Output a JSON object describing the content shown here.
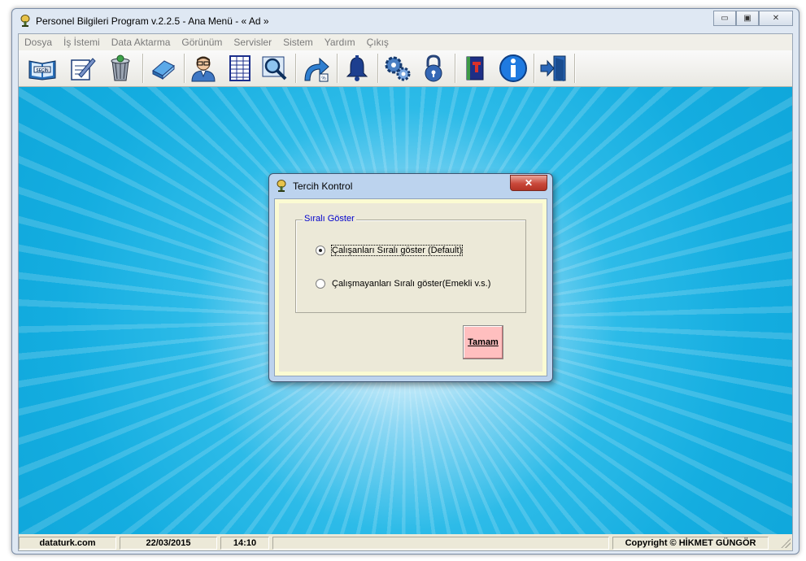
{
  "window": {
    "title": "Personel Bilgileri Program v.2.2.5  - Ana Menü -  « Ad »",
    "caption_buttons": [
      "minimize-icon",
      "maximize-icon",
      "close-icon"
    ]
  },
  "menu": [
    "Dosya",
    "İş İstemi",
    "Data Aktarma",
    "Görünüm",
    "Servisler",
    "Sistem",
    "Yardım",
    "Çıkış"
  ],
  "toolbar": [
    {
      "name": "secim-book-icon",
      "text": "SEÇİN"
    },
    {
      "name": "edit-form-icon"
    },
    {
      "name": "recycle-bin-icon"
    },
    {
      "name": "eraser-icon"
    },
    {
      "name": "person-icon"
    },
    {
      "name": "spreadsheet-icon"
    },
    {
      "name": "search-icon"
    },
    {
      "name": "export-arrow-icon"
    },
    {
      "name": "bell-icon"
    },
    {
      "name": "gears-icon"
    },
    {
      "name": "lock-icon"
    },
    {
      "name": "help-book-icon"
    },
    {
      "name": "info-icon"
    },
    {
      "name": "exit-door-icon"
    }
  ],
  "status": {
    "site": "dataturk.com",
    "date": "22/03/2015",
    "time": "14:10",
    "copyright": "Copyright © HİKMET GÜNGÖR"
  },
  "dialog": {
    "title": "Tercih Kontrol",
    "group_label": "Sıralı Göster",
    "options": [
      {
        "label": "Çalışanları Sıralı göster (Default)",
        "checked": true
      },
      {
        "label": "Çalışmayanları Sıralı göster(Emekli v.s.)",
        "checked": false
      }
    ],
    "ok_label": "Tamam",
    "colors": {
      "ok_bg": "#ffbfbf",
      "group_label": "#0000cc",
      "client_border": "#fbfbd2"
    }
  },
  "colors": {
    "desktop": "#14ade0"
  }
}
